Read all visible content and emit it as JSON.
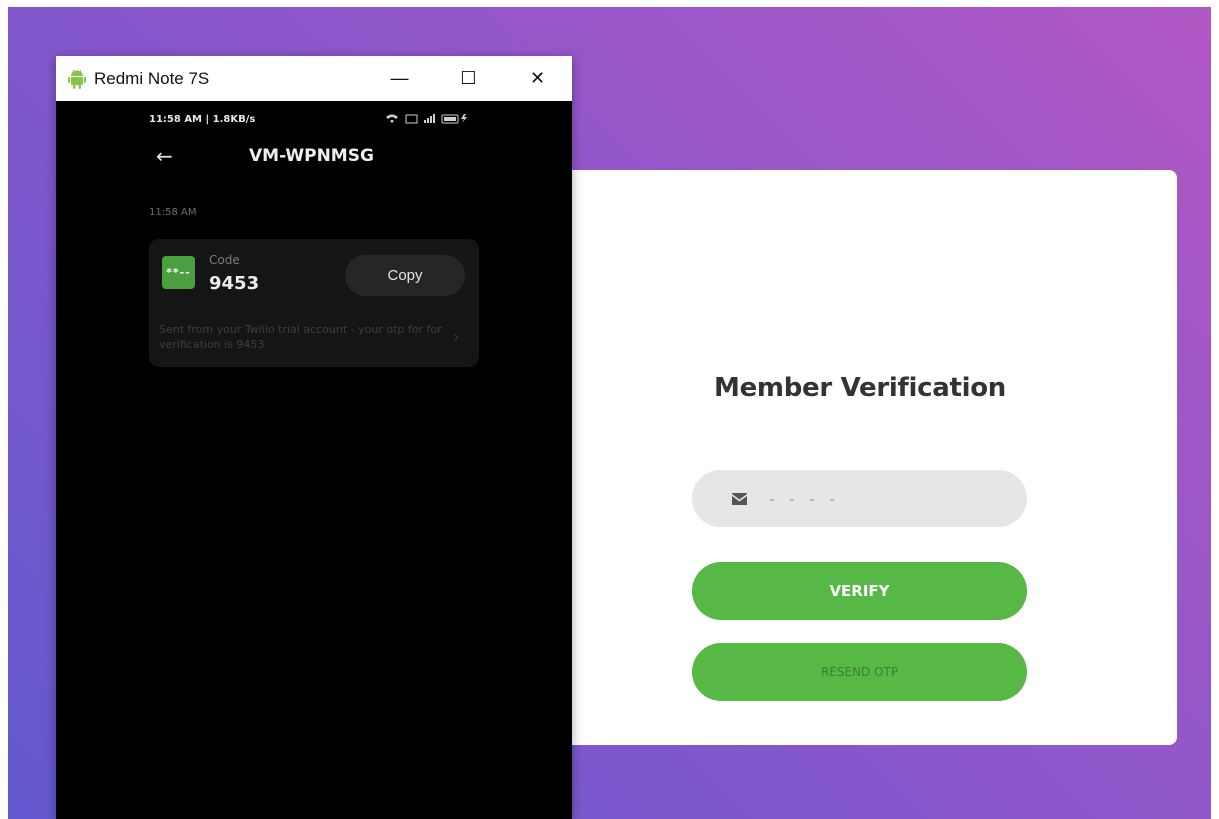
{
  "colors": {
    "gradient_start": "#b057c3",
    "gradient_end": "#6258cf",
    "accent_green": "#57b846",
    "card_bg": "#ffffff",
    "field_bg": "#e6e6e6"
  },
  "emulator": {
    "window_title": "Redmi Note 7S",
    "window_icon": "android-icon",
    "controls": {
      "minimize": "—",
      "maximize": "☐",
      "close": "✕"
    },
    "status_bar": {
      "left": "11:58 AM | 1.8KB/s",
      "right": "wifi signal battery"
    },
    "conversation": {
      "contact": "VM-WPNMSG",
      "timestamp": "11:58 AM",
      "message": {
        "badge": "**--",
        "code_label": "Code",
        "code_value": "9453",
        "copy_label": "Copy",
        "body": "Sent from your Twilio trial account - your otp for for verification is 9453"
      }
    }
  },
  "form": {
    "title": "Member Verification",
    "otp_placeholder": "- - - -",
    "verify_label": "VERIFY",
    "resend_label": "RESEND OTP"
  }
}
